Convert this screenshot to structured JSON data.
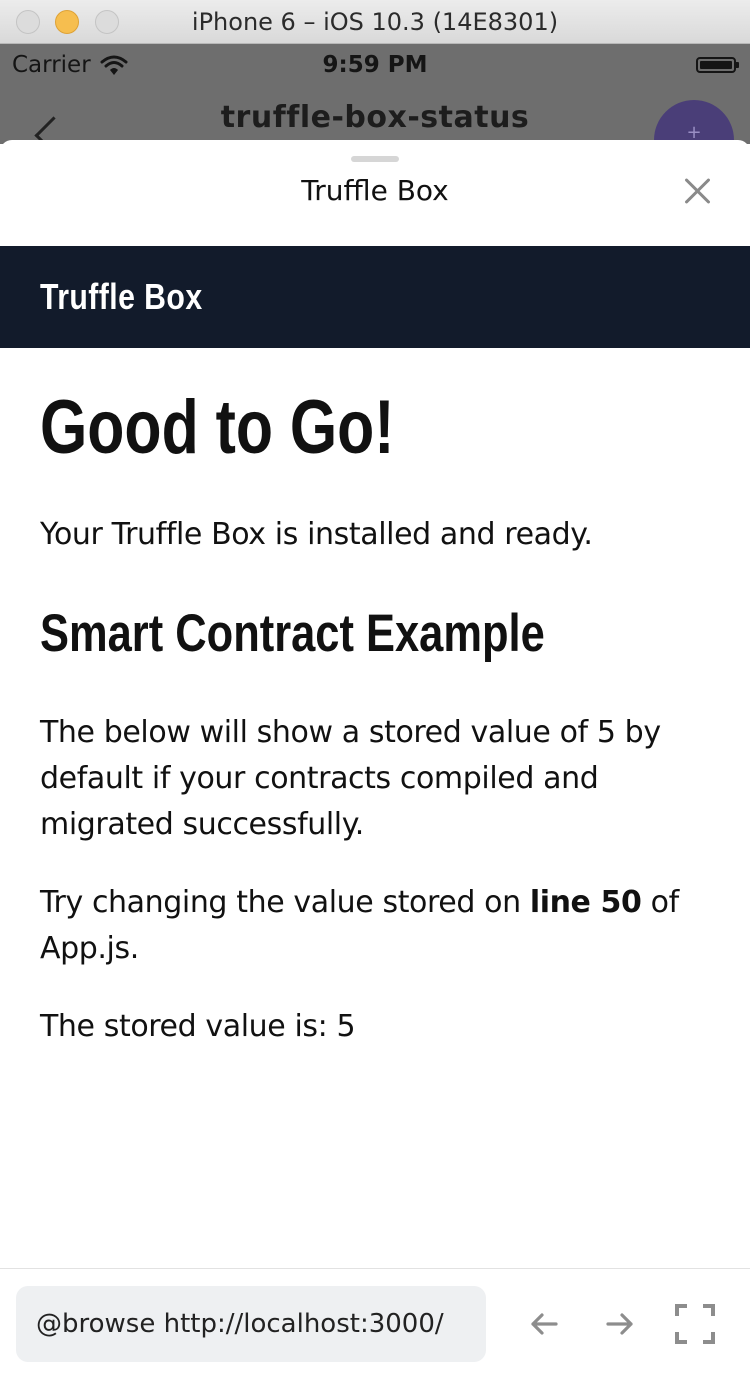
{
  "simulator": {
    "title": "iPhone 6 – iOS 10.3 (14E8301)"
  },
  "statusbar": {
    "carrier": "Carrier",
    "time": "9:59 PM"
  },
  "behind": {
    "title": "truffle-box-status",
    "fab_label": "+"
  },
  "sheet": {
    "title": "Truffle Box"
  },
  "page": {
    "brand": "Truffle Box",
    "heading": "Good to Go!",
    "intro": "Your Truffle Box is installed and ready.",
    "subheading": "Smart Contract Example",
    "below_text": "The below will show a stored value of 5 by default if your contracts compiled and migrated successfully.",
    "try_prefix": "Try changing the value stored on ",
    "try_strong": "line 50",
    "try_suffix": " of App.js.",
    "stored_value": "The stored value is: 5"
  },
  "bottombar": {
    "url": "@browse http://localhost:3000/",
    "icons": [
      "arrow-left-icon",
      "arrow-right-icon",
      "expand-icon"
    ]
  },
  "colors": {
    "navbar_bg": "#121b2b",
    "fab_bg": "#4a3e78",
    "traffic_min": "#f6be4f",
    "url_field_bg": "#eef0f2"
  }
}
